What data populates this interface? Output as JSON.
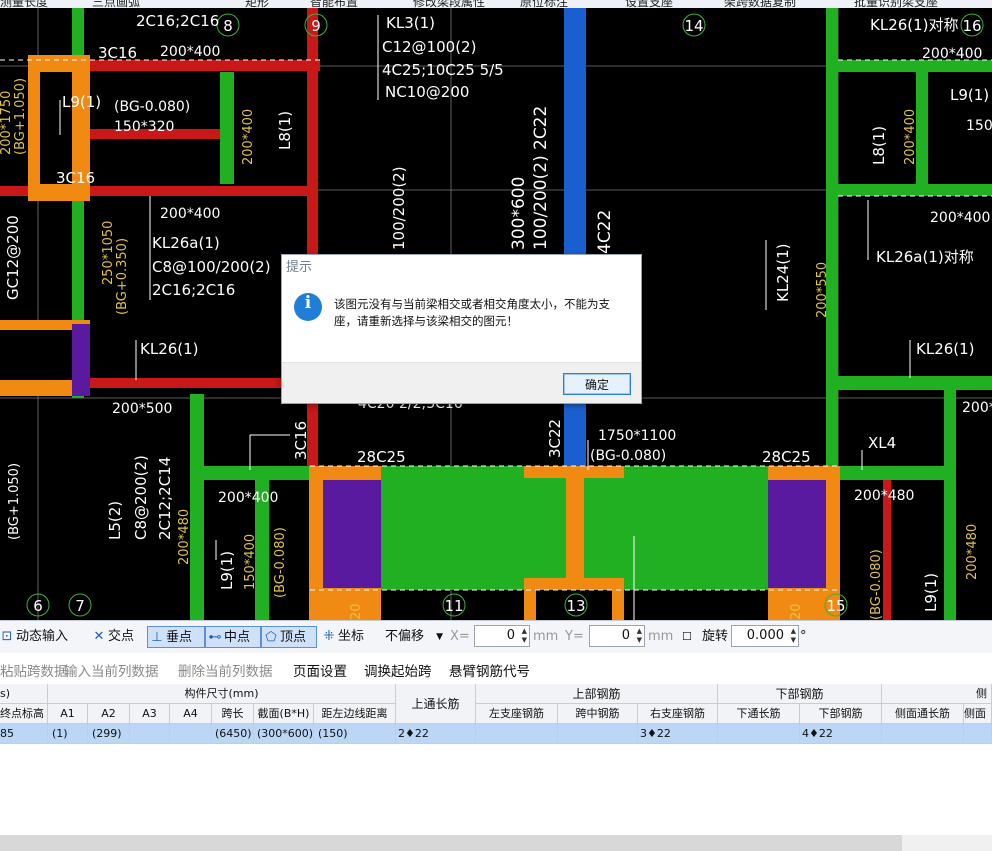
{
  "toolbar": {
    "items": [
      "测量长度",
      "三点画弧",
      "矩形",
      "智能布置",
      "修改梁段属性",
      "原位标注",
      "设置支座",
      "架跨数据复制",
      "批量识别梁支座"
    ]
  },
  "canvas": {
    "texts": [
      "2C16;2C16",
      "KL3(1)",
      "C12@100(2)",
      "4C25;10C25 5/5",
      "NC10@200",
      "200*400",
      "3C16",
      "L9(1)",
      "(BG-0.080)",
      "150*320",
      "200*1750",
      "(BG+1.050)",
      "200*400",
      "L8(1)",
      "3C16",
      "200*400",
      "KL26a(1)",
      "C8@100/200(2)",
      "2C16;2C16",
      "GC12@200",
      "250*1050",
      "(BG+0.350)",
      "KL26(1)",
      "200*500",
      "KL26(1)对称",
      "200*400",
      "L9(1)",
      "150",
      "L8(1)",
      "200*400",
      "200*400",
      "KL26a(1)对称",
      "KL24(1)",
      "200*550",
      "KL26(1)",
      "200*",
      "1750*1100",
      "(BG-0.080)",
      "28C25",
      "28C25",
      "200*400",
      "L5(2)",
      "C8@200(2)",
      "2C12;2C14",
      "200*480",
      "L9(1)",
      "150*400",
      "(BG-0.080)",
      "3C16",
      "3C22",
      "200*480",
      "XL4",
      "200*480",
      "L9(1)",
      "(BG+1.050)",
      "2C22",
      "100/200(2)",
      "300*600",
      "4C22",
      "4C20 2/2;3C16",
      "(BG-0.080)",
      "L9(1)",
      "20",
      "20"
    ],
    "axis_labels": [
      "8",
      "9",
      "14",
      "16",
      "6",
      "7",
      "11",
      "13",
      "15"
    ]
  },
  "dialog": {
    "title": "提示",
    "message": "该图元没有与当前梁相交或者相交角度太小，不能为支座，请重新选择与该梁相交的图元！",
    "ok_label": "确定",
    "icon": "info-icon"
  },
  "snap": {
    "dynamic_input": "动态输入",
    "intersection": "交点",
    "perpendicular": "垂点",
    "midpoint": "中点",
    "vertex": "顶点",
    "coordinate": "坐标",
    "offset_select": "不偏移",
    "x_label": "X=",
    "x_value": "0",
    "y_label": "Y=",
    "y_value": "0",
    "unit": "mm",
    "rotate_label": "旋转",
    "rotate_value": "0.000",
    "degree": "°"
  },
  "commands": {
    "paste": "粘贴跨数据",
    "input_col": "输入当前列数据",
    "delete_col": "删除当前列数据",
    "page_setup": "页面设置",
    "start_span": "调换起始跨",
    "cantilever": "悬臂钢筋代号"
  },
  "table": {
    "group_headers": [
      "s)",
      "构件尺寸(mm)",
      "上通长筋",
      "上部钢筋",
      "下部钢筋",
      "侧"
    ],
    "columns": [
      "终点标高",
      "A1",
      "A2",
      "A3",
      "A4",
      "跨长",
      "截面(B*H)",
      "距左边线距离",
      "左支座钢筋",
      "跨中钢筋",
      "右支座钢筋",
      "下通长筋",
      "下部钢筋",
      "侧面通长筋",
      "侧面"
    ],
    "row": [
      "85",
      "(1)",
      "(299)",
      "",
      "",
      "(6450)",
      "(300*600)",
      "(150)",
      "2♦22",
      "",
      "",
      "3♦22",
      "",
      "4♦22",
      "",
      ""
    ]
  },
  "colors": {
    "canvas_bg": "#000000",
    "beam_red": "#c81818",
    "beam_green": "#21b021",
    "beam_blue": "#1a5fd0",
    "column_orange": "#f08a12",
    "column_purple": "#5a1aa0",
    "selection_row": "#bcd7f5",
    "dialog_accent": "#1f7fd8"
  }
}
